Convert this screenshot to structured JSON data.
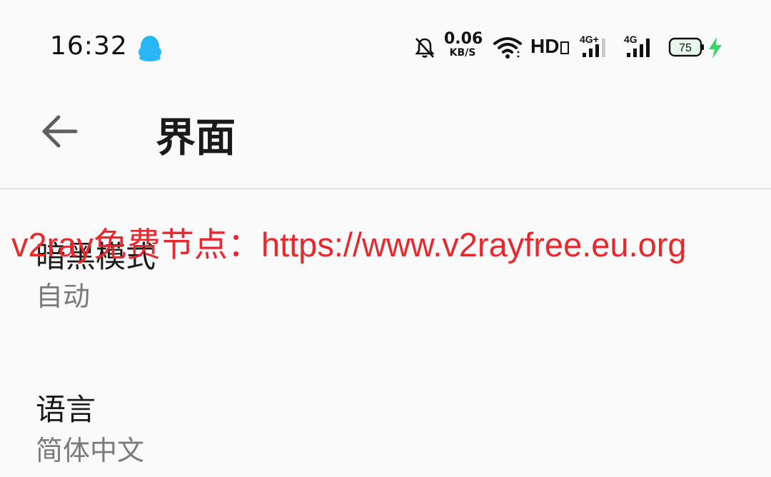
{
  "status_bar": {
    "time": "16:32",
    "app_icon": "qq-penguin-icon",
    "net_speed_value": "0.06",
    "net_speed_unit": "KB/S",
    "hd_label": "HD",
    "sim1_label": "4G+",
    "sim2_label": "4G",
    "battery_level": "75",
    "icons": [
      "bell-off-icon",
      "wifi-icon",
      "signal-icon",
      "battery-icon",
      "charging-bolt-icon"
    ],
    "colors": {
      "charging": "#3dd36b",
      "qq": "#29b6f6"
    }
  },
  "toolbar": {
    "back_icon": "arrow-left-icon",
    "title": "界面"
  },
  "settings": [
    {
      "title": "暗黑模式",
      "summary": "自动"
    },
    {
      "title": "语言",
      "summary": "简体中文"
    }
  ],
  "watermark": {
    "text": "v2ray免费节点：https://www.v2rayfree.eu.org",
    "color": "#e8282c"
  }
}
